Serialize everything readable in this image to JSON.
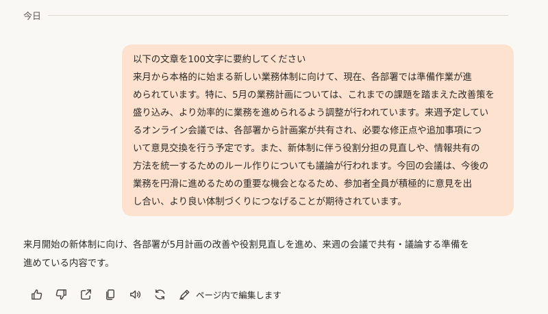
{
  "divider": {
    "label": "今日"
  },
  "user_message": {
    "lines": [
      "以下の文章を100文字に要約してください",
      "来月から本格的に始まる新しい業務体制に向けて、現在、各部署では準備作業が進",
      "められています。特に、5月の業務計画については、これまでの課題を踏まえた改善策を",
      "盛り込み、より効率的に業務を進められるよう調整が行われています。来週予定してい",
      "るオンライン会議では、各部署から計画案が共有され、必要な修正点や追加事項につ",
      "いて意見交換を行う予定です。また、新体制に伴う役割分担の見直しや、情報共有の",
      "方法を統一するためのルール作りについても議論が行われます。今回の会議は、今後の",
      "業務を円滑に進めるための重要な機会となるため、参加者全員が積極的に意見を出",
      "し合い、より良い体制づくりにつなげることが期待されています。"
    ]
  },
  "assistant_message": {
    "lines": [
      "来月開始の新体制に向け、各部署が5月計画の改善や役割見直しを進め、来週の会議で共有・議論する準備を",
      "進めている内容です。"
    ]
  },
  "actions": {
    "icons": [
      "thumbs-up-icon",
      "thumbs-down-icon",
      "share-icon",
      "copy-icon",
      "speaker-icon",
      "regenerate-icon",
      "edit-icon"
    ],
    "edit_label": "ページ内で編集します"
  },
  "colors": {
    "background": "#faf8f4",
    "user_bubble": "#fde3cf",
    "text": "#2b2925",
    "divider": "#dcd7cf"
  }
}
